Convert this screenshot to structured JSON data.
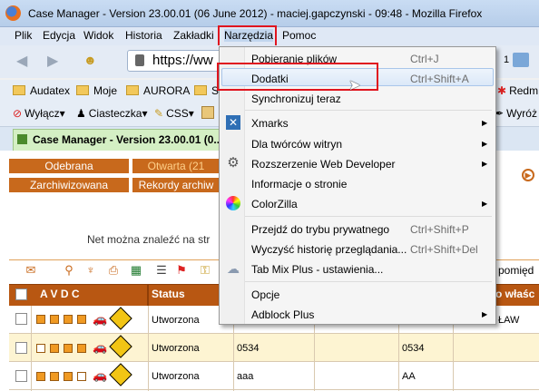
{
  "window": {
    "title": "Case Manager - Version 23.00.01 (06 June 2012) - maciej.gapczynski - 09:48 - Mozilla Firefox"
  },
  "menu": [
    "Plik",
    "Edycja",
    "Widok",
    "Historia",
    "Zakładki",
    "Narzędzia",
    "Pomoc"
  ],
  "nav": {
    "url": "https://ww",
    "right_text": "1"
  },
  "bookmarks_row1": [
    "Audatex",
    "Moje",
    "AURORA",
    "S",
    "Redm"
  ],
  "bookmarks_row2": [
    "Wyłącz▾",
    "Ciasteczka▾",
    "CSS▾",
    "Wyróż"
  ],
  "tab": {
    "title": "Case Manager - Version 23.00.01 (0..."
  },
  "content": {
    "buttons": [
      "Odebrana",
      "Otwarta (21",
      "Zarchiwizowana",
      "Rekordy archiw"
    ],
    "message": "Net można znaleźć na str",
    "right_label": "pomięd",
    "columns": [
      "A V D C",
      "Status",
      "o właśc"
    ],
    "rows": [
      {
        "status": "Utworzona",
        "col3": "",
        "col5": "ŁAW"
      },
      {
        "status": "Utworzona",
        "col3": "0534",
        "col5": "0534"
      },
      {
        "status": "Utworzona",
        "col3": "aaa",
        "col5": "AA"
      }
    ]
  },
  "dropdown": {
    "items": [
      {
        "label": "Pobieranie plików",
        "shortcut": "Ctrl+J"
      },
      {
        "label": "Dodatki",
        "shortcut": "Ctrl+Shift+A"
      },
      {
        "label": "Synchronizuj teraz",
        "shortcut": ""
      },
      {
        "label": "Xmarks",
        "shortcut": ""
      },
      {
        "label": "Dla twórców witryn",
        "shortcut": ""
      },
      {
        "label": "Rozszerzenie Web Developer",
        "shortcut": ""
      },
      {
        "label": "Informacje o stronie",
        "shortcut": ""
      },
      {
        "label": "ColorZilla",
        "shortcut": ""
      },
      {
        "label": "Przejdź do trybu prywatnego",
        "shortcut": "Ctrl+Shift+P"
      },
      {
        "label": "Wyczyść historię przeglądania...",
        "shortcut": "Ctrl+Shift+Del"
      },
      {
        "label": "Tab Mix Plus - ustawienia...",
        "shortcut": ""
      },
      {
        "label": "Opcje",
        "shortcut": ""
      },
      {
        "label": "Adblock Plus",
        "shortcut": ""
      }
    ]
  },
  "colors": {
    "highlight": "#e0151f",
    "orange": "#c8691c",
    "header": "#b85712"
  }
}
